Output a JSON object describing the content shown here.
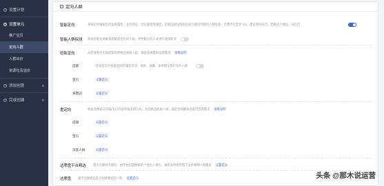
{
  "sidebar": {
    "steps": [
      {
        "num": "1",
        "label": "设置计划"
      },
      {
        "num": "2",
        "label": "设置单元"
      },
      {
        "num": "3",
        "label": "添加创意"
      },
      {
        "num": "4",
        "label": "完成创建"
      }
    ],
    "subitems": [
      "推广宝贝",
      "定向人群",
      "人群出价",
      "资源位及溢价"
    ]
  },
  "panel": {
    "title": "定向人群",
    "smart": {
      "label": "智能定向",
      "desc": "系统实时根据您的设备属性、业务特征、宝贝属性等维度，智能匹配投放的访客只要您可能的人群投放，仍需不大定步 5%，建议保持开启。若推送人数加，开启后"
    },
    "smart_detect": {
      "label": "智能人群探测",
      "desc": "系统智能化地推荐可能适合您的人群，并用能力的方式进行测测新领"
    },
    "interest": {
      "label": "拉新定向",
      "desc": "从店铺和宝贝维度帮将更精品维推人群，满足多维度的拉新需求",
      "link": "查看说明",
      "shop_label": "店铺",
      "shop_desc": "店铺及实时智能反映店铺有浏览、搜索、收藏、加购物车等行为的人群",
      "baby_label": "宝贝",
      "baby_link": "设置定向",
      "keyword_label": "关键词",
      "keyword_link": "设置定向"
    },
    "retarget": {
      "label": "重定向",
      "desc": "根据消费者在店铺/宝贝内容等维度的行为，为您精选优质人群，满足您唤醒和老客召回的需求",
      "link": "查看说明",
      "shop_label": "店铺",
      "shop_link": "设置定向",
      "baby_label": "宝贝",
      "baby_link": "设置定向",
      "deep_label": "深度人群",
      "deep_link": "设置定向"
    },
    "dmp": {
      "label": "达摩盘平台精选",
      "desc": "基于达摩盘丰富的、由平台配置数据的个性化人群包，满足多场景营销下业务精细人群需求",
      "link": "设置定向"
    },
    "dmp2": {
      "label": "达摩盘",
      "desc": "基于达摩盘自定义创建圈选的人群",
      "link": "设置定向"
    }
  },
  "watermark": "头条 @那木说运营"
}
